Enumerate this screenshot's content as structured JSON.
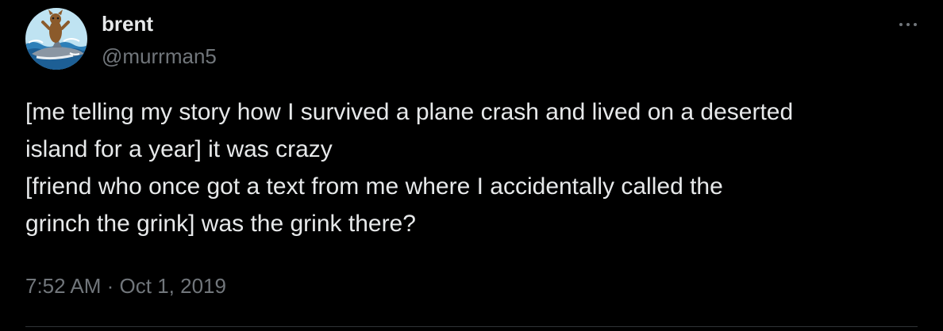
{
  "author": {
    "name": "brent",
    "handle": "@murrman5"
  },
  "tweet": {
    "lines": [
      "[me telling my story how I survived a plane crash and lived on a deserted",
      "island for a year] it was crazy",
      "[friend who once got a text from me where I accidentally called the",
      "grinch the grink] was the grink there?"
    ]
  },
  "meta": {
    "time": "7:52 AM",
    "separator": "·",
    "date": "Oct 1, 2019"
  },
  "icons": {
    "more": "more-horizontal-icon",
    "avatar": "avatar-icon"
  },
  "colors": {
    "background": "#000000",
    "primary_text": "#e7e9ea",
    "secondary_text": "#71767b",
    "divider": "#2f3336"
  }
}
